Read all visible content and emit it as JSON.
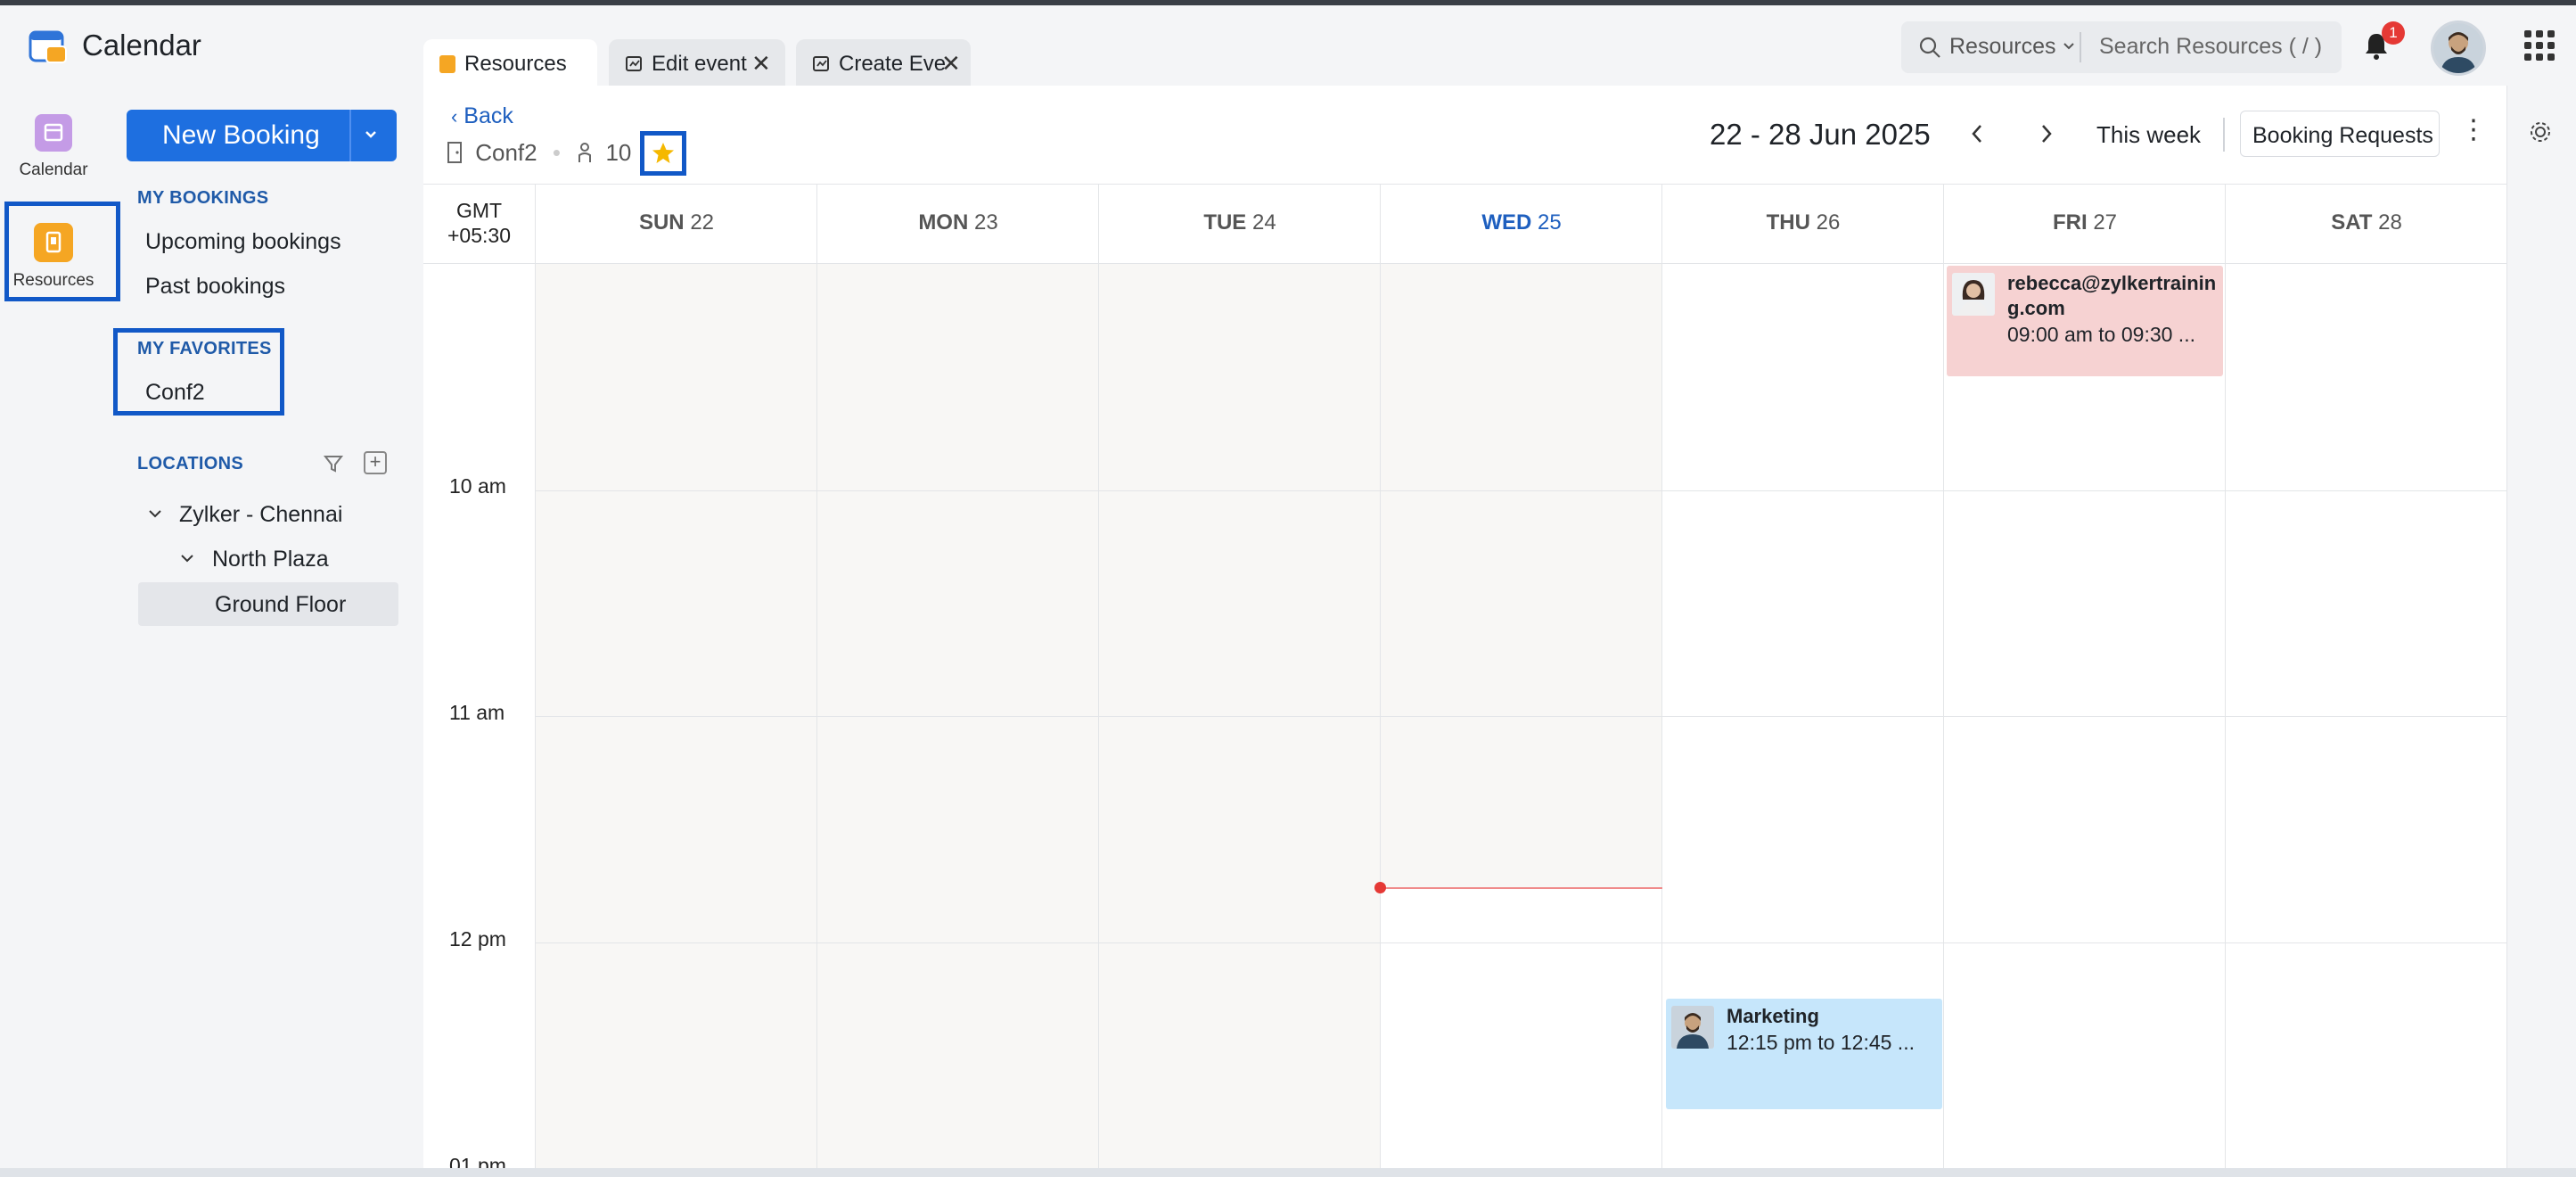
{
  "app": {
    "title": "Calendar"
  },
  "rail": {
    "calendar": "Calendar",
    "resources": "Resources"
  },
  "sidebar": {
    "new_booking": "New Booking",
    "my_bookings": {
      "heading": "MY BOOKINGS",
      "items": [
        "Upcoming bookings",
        "Past bookings"
      ]
    },
    "my_favorites": {
      "heading": "MY FAVORITES",
      "items": [
        "Conf2"
      ]
    },
    "locations": {
      "heading": "LOCATIONS",
      "tree": [
        "Zylker - Chennai",
        "North Plaza",
        "Ground Floor"
      ]
    }
  },
  "tabs": [
    "Resources",
    "Edit event",
    "Create Eve"
  ],
  "search": {
    "scope": "Resources",
    "placeholder": "Search Resources ( / )"
  },
  "notifications": {
    "count": "1"
  },
  "resource": {
    "back": "Back",
    "name": "Conf2",
    "capacity": "10"
  },
  "toolbar": {
    "date_range": "22 - 28 Jun 2025",
    "this_week": "This week",
    "booking_requests": "Booking Requests"
  },
  "calendar": {
    "timezone_line1": "GMT",
    "timezone_line2": "+05:30",
    "days": [
      {
        "name": "SUN",
        "num": "22"
      },
      {
        "name": "MON",
        "num": "23"
      },
      {
        "name": "TUE",
        "num": "24"
      },
      {
        "name": "WED",
        "num": "25",
        "today": true
      },
      {
        "name": "THU",
        "num": "26"
      },
      {
        "name": "FRI",
        "num": "27"
      },
      {
        "name": "SAT",
        "num": "28"
      }
    ],
    "times": [
      "10 am",
      "11 am",
      "12 pm",
      "01 pm"
    ],
    "events": [
      {
        "title": "rebecca@zylkertraining.com",
        "time": "09:00 am to 09:30 ...",
        "color": "#f6d2d2",
        "day": "FRI 27"
      },
      {
        "title": "Marketing",
        "time": "12:15 pm to 12:45 ...",
        "color": "#c6e6fb",
        "day": "THU 26"
      }
    ]
  },
  "colors": {
    "accent": "#1e6fe0",
    "highlight_box": "#1158c7",
    "today": "#1e5fbf",
    "now_line": "#e53935",
    "favorite_star": "#f5b800"
  }
}
